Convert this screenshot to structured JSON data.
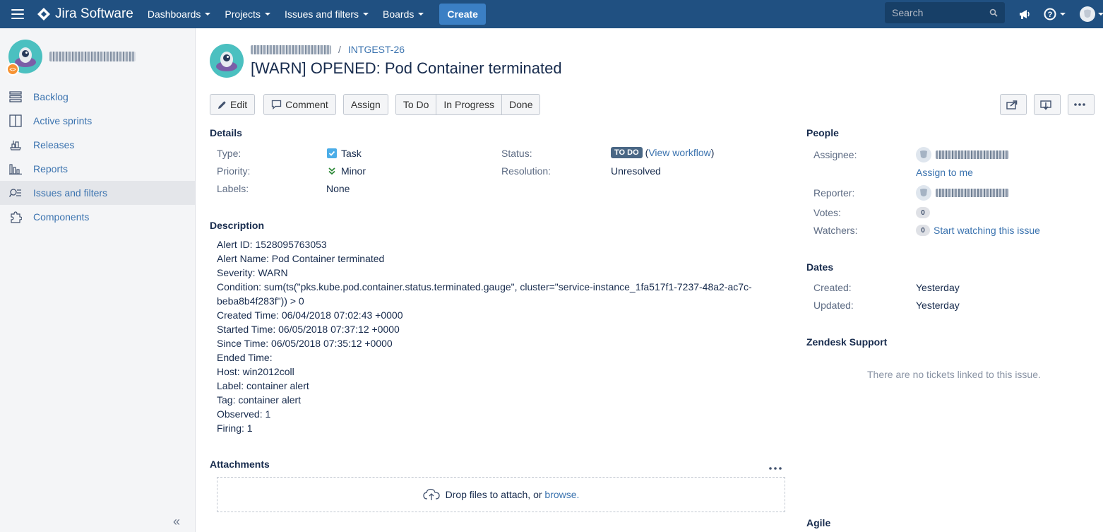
{
  "app": {
    "brand": "Jira Software",
    "brand_color": "#205081",
    "link_color": "#3b73af"
  },
  "topnav": {
    "items": [
      {
        "label": "Dashboards"
      },
      {
        "label": "Projects"
      },
      {
        "label": "Issues and filters"
      },
      {
        "label": "Boards"
      }
    ],
    "create_label": "Create",
    "search_placeholder": "Search",
    "icons": [
      "menu-icon",
      "jira-logo-icon",
      "search-icon",
      "megaphone-icon",
      "help-icon",
      "user-avatar-icon"
    ]
  },
  "sidebar": {
    "items": [
      {
        "label": "Backlog",
        "icon": "backlog-icon",
        "active": false
      },
      {
        "label": "Active sprints",
        "icon": "active-sprints-icon",
        "active": false
      },
      {
        "label": "Releases",
        "icon": "releases-icon",
        "active": false
      },
      {
        "label": "Reports",
        "icon": "reports-icon",
        "active": false
      },
      {
        "label": "Issues and filters",
        "icon": "issues-filters-icon",
        "active": true
      },
      {
        "label": "Components",
        "icon": "components-icon",
        "active": false
      }
    ],
    "collapse_glyph": "«"
  },
  "issue": {
    "breadcrumb_sep": "/",
    "key": "INTGEST-26",
    "title": "[WARN] OPENED: Pod Container terminated"
  },
  "toolbar": {
    "edit": "Edit",
    "comment": "Comment",
    "assign": "Assign",
    "workflow": [
      "To Do",
      "In Progress",
      "Done"
    ]
  },
  "details": {
    "heading": "Details",
    "type_label": "Type:",
    "type_value": "Task",
    "priority_label": "Priority:",
    "priority_value": "Minor",
    "labels_label": "Labels:",
    "labels_value": "None",
    "status_label": "Status:",
    "status_value": "TO DO",
    "status_open_paren": "(",
    "view_workflow": "View workflow",
    "status_close_paren": ")",
    "resolution_label": "Resolution:",
    "resolution_value": "Unresolved"
  },
  "description": {
    "heading": "Description",
    "lines": [
      "Alert ID: 1528095763053",
      "Alert Name: Pod Container terminated",
      "Severity: WARN",
      "Condition: sum(ts(\"pks.kube.pod.container.status.terminated.gauge\", cluster=\"service-instance_1fa517f1-7237-48a2-ac7c-beba8b4f283f\")) > 0",
      "Created Time: 06/04/2018 07:02:43 +0000",
      "Started Time: 06/05/2018 07:37:12 +0000",
      "Since Time: 06/05/2018 07:35:12 +0000",
      "Ended Time:",
      "Host: win2012coll",
      "Label: container alert",
      "Tag: container alert",
      "Observed: 1",
      "Firing: 1"
    ]
  },
  "attachments": {
    "heading": "Attachments",
    "drop_text": "Drop files to attach, or ",
    "browse": "browse."
  },
  "people": {
    "heading": "People",
    "assignee_label": "Assignee:",
    "assign_to_me": "Assign to me",
    "reporter_label": "Reporter:",
    "votes_label": "Votes:",
    "votes_count": "0",
    "watchers_label": "Watchers:",
    "watchers_count": "0",
    "start_watching": "Start watching this issue"
  },
  "dates": {
    "heading": "Dates",
    "created_label": "Created:",
    "created_value": "Yesterday",
    "updated_label": "Updated:",
    "updated_value": "Yesterday"
  },
  "zendesk": {
    "heading": "Zendesk Support",
    "empty": "There are no tickets linked to this issue."
  },
  "agile": {
    "heading": "Agile"
  }
}
